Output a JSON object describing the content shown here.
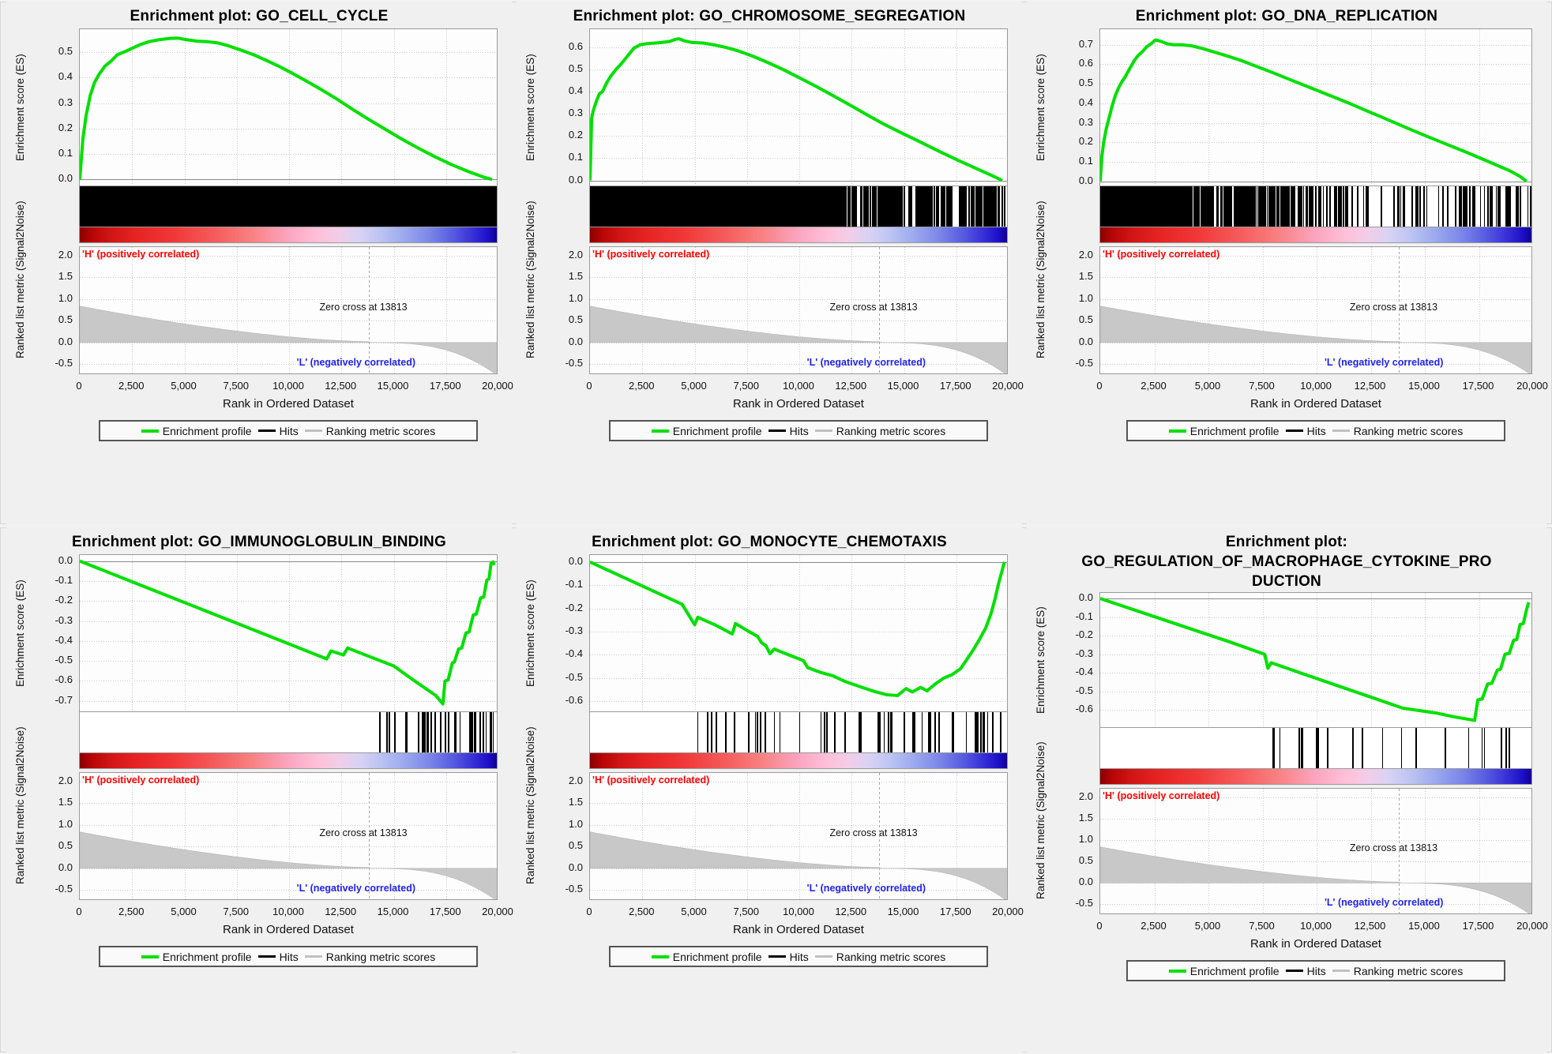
{
  "figure": {
    "background": "#f2f2f2",
    "legend": {
      "enrichment_profile": "Enrichment profile",
      "hits": "Hits",
      "ranking_metric": "Ranking metric scores",
      "colors": {
        "profile": "#00e000",
        "hits": "#000000",
        "metric": "#c0c0c0"
      }
    },
    "common": {
      "xlabel": "Rank in Ordered Dataset",
      "ylabel_es": "Enrichment score (ES)",
      "ylabel_metric": "Ranked list metric (Signal2Noise)",
      "pos_label": "'H' (positively correlated)",
      "neg_label": "'L' (negatively correlated)",
      "zero_cross_label": "Zero cross at 13813",
      "zero_cross_rank": 13813,
      "xticks": [
        "0",
        "2,500",
        "5,000",
        "7,500",
        "10,000",
        "12,500",
        "15,000",
        "17,500",
        "20,000"
      ],
      "xtick_values": [
        0,
        2500,
        5000,
        7500,
        10000,
        12500,
        15000,
        17500,
        20000
      ],
      "xlim": [
        0,
        20000
      ],
      "metric_yticks": [
        "2.0",
        "1.5",
        "1.0",
        "0.5",
        "0.0",
        "-0.5"
      ],
      "metric_ylim": [
        -0.75,
        2.2
      ],
      "pos_color": "#ff0000",
      "neg_color": "#2222ee"
    }
  },
  "chart_data": [
    {
      "id": "cell-cycle",
      "type": "line",
      "title": "Enrichment plot: GO_CELL_CYCLE",
      "gene_set": "GO_CELL_CYCLE",
      "xlabel": "Rank in Ordered Dataset",
      "ylabel": "Enrichment score (ES)",
      "xlim": [
        0,
        20000
      ],
      "ylim": [
        -0.03,
        0.59
      ],
      "yticks": [
        "0.0",
        "0.1",
        "0.2",
        "0.3",
        "0.4",
        "0.5"
      ],
      "ytick_values": [
        0.0,
        0.1,
        0.2,
        0.3,
        0.4,
        0.5
      ],
      "peak_es": 0.555,
      "peak_rank": 4700,
      "direction": "positive",
      "grid": true,
      "es_curve": [
        [
          0,
          0.0
        ],
        [
          150,
          0.16
        ],
        [
          300,
          0.25
        ],
        [
          500,
          0.33
        ],
        [
          700,
          0.38
        ],
        [
          900,
          0.41
        ],
        [
          1200,
          0.445
        ],
        [
          1500,
          0.465
        ],
        [
          1800,
          0.49
        ],
        [
          2100,
          0.5
        ],
        [
          2500,
          0.515
        ],
        [
          2900,
          0.53
        ],
        [
          3300,
          0.541
        ],
        [
          3800,
          0.549
        ],
        [
          4300,
          0.554
        ],
        [
          4700,
          0.555
        ],
        [
          5100,
          0.549
        ],
        [
          5600,
          0.543
        ],
        [
          6100,
          0.541
        ],
        [
          6600,
          0.536
        ],
        [
          7100,
          0.525
        ],
        [
          7700,
          0.508
        ],
        [
          8300,
          0.49
        ],
        [
          8900,
          0.468
        ],
        [
          9500,
          0.445
        ],
        [
          10200,
          0.415
        ],
        [
          10900,
          0.383
        ],
        [
          11600,
          0.35
        ],
        [
          12300,
          0.315
        ],
        [
          13000,
          0.277
        ],
        [
          13800,
          0.236
        ],
        [
          14600,
          0.197
        ],
        [
          15400,
          0.158
        ],
        [
          16200,
          0.122
        ],
        [
          17000,
          0.088
        ],
        [
          17800,
          0.057
        ],
        [
          18600,
          0.03
        ],
        [
          19300,
          0.009
        ],
        [
          19700,
          0.0
        ]
      ],
      "hits_density": "very-high"
    },
    {
      "id": "chromosome-segregation",
      "type": "line",
      "title": "Enrichment plot: GO_CHROMOSOME_SEGREGATION",
      "gene_set": "GO_CHROMOSOME_SEGREGATION",
      "xlabel": "Rank in Ordered Dataset",
      "ylabel": "Enrichment score (ES)",
      "xlim": [
        0,
        20000
      ],
      "ylim": [
        -0.03,
        0.68
      ],
      "yticks": [
        "0.0",
        "0.1",
        "0.2",
        "0.3",
        "0.4",
        "0.5",
        "0.6"
      ],
      "ytick_values": [
        0.0,
        0.1,
        0.2,
        0.3,
        0.4,
        0.5,
        0.6
      ],
      "peak_es": 0.637,
      "peak_rank": 4250,
      "direction": "positive",
      "grid": true,
      "es_curve": [
        [
          0,
          0.0
        ],
        [
          80,
          0.28
        ],
        [
          160,
          0.315
        ],
        [
          300,
          0.355
        ],
        [
          450,
          0.39
        ],
        [
          600,
          0.4
        ],
        [
          800,
          0.44
        ],
        [
          1000,
          0.47
        ],
        [
          1250,
          0.5
        ],
        [
          1500,
          0.525
        ],
        [
          1800,
          0.56
        ],
        [
          2100,
          0.595
        ],
        [
          2400,
          0.61
        ],
        [
          2700,
          0.615
        ],
        [
          3000,
          0.617
        ],
        [
          3400,
          0.62
        ],
        [
          3800,
          0.625
        ],
        [
          4100,
          0.635
        ],
        [
          4250,
          0.637
        ],
        [
          4500,
          0.628
        ],
        [
          4900,
          0.62
        ],
        [
          5400,
          0.618
        ],
        [
          5900,
          0.61
        ],
        [
          6500,
          0.598
        ],
        [
          7100,
          0.582
        ],
        [
          7800,
          0.558
        ],
        [
          8500,
          0.53
        ],
        [
          9200,
          0.5
        ],
        [
          10000,
          0.462
        ],
        [
          10800,
          0.423
        ],
        [
          11600,
          0.382
        ],
        [
          12400,
          0.34
        ],
        [
          13200,
          0.297
        ],
        [
          14000,
          0.255
        ],
        [
          14900,
          0.213
        ],
        [
          15800,
          0.172
        ],
        [
          16700,
          0.13
        ],
        [
          17600,
          0.09
        ],
        [
          18500,
          0.052
        ],
        [
          19200,
          0.022
        ],
        [
          19700,
          0.0
        ]
      ],
      "hits_density": "high"
    },
    {
      "id": "dna-replication",
      "type": "line",
      "title": "Enrichment plot: GO_DNA_REPLICATION",
      "gene_set": "GO_DNA_REPLICATION",
      "xlabel": "Rank in Ordered Dataset",
      "ylabel": "Enrichment score (ES)",
      "xlim": [
        0,
        20000
      ],
      "ylim": [
        -0.03,
        0.78
      ],
      "yticks": [
        "0.0",
        "0.1",
        "0.2",
        "0.3",
        "0.4",
        "0.5",
        "0.6",
        "0.7"
      ],
      "ytick_values": [
        0.0,
        0.1,
        0.2,
        0.3,
        0.4,
        0.5,
        0.6,
        0.7
      ],
      "peak_es": 0.725,
      "peak_rank": 2550,
      "direction": "positive",
      "grid": true,
      "es_curve": [
        [
          0,
          0.0
        ],
        [
          80,
          0.13
        ],
        [
          160,
          0.2
        ],
        [
          280,
          0.27
        ],
        [
          420,
          0.33
        ],
        [
          560,
          0.39
        ],
        [
          700,
          0.44
        ],
        [
          850,
          0.48
        ],
        [
          1000,
          0.51
        ],
        [
          1150,
          0.535
        ],
        [
          1350,
          0.575
        ],
        [
          1550,
          0.615
        ],
        [
          1750,
          0.645
        ],
        [
          1950,
          0.665
        ],
        [
          2150,
          0.69
        ],
        [
          2350,
          0.705
        ],
        [
          2550,
          0.725
        ],
        [
          2800,
          0.718
        ],
        [
          3100,
          0.705
        ],
        [
          3400,
          0.7
        ],
        [
          3800,
          0.7
        ],
        [
          4200,
          0.695
        ],
        [
          4700,
          0.682
        ],
        [
          5200,
          0.665
        ],
        [
          5800,
          0.645
        ],
        [
          6500,
          0.62
        ],
        [
          7200,
          0.59
        ],
        [
          8000,
          0.556
        ],
        [
          8800,
          0.52
        ],
        [
          9600,
          0.485
        ],
        [
          10500,
          0.445
        ],
        [
          11400,
          0.405
        ],
        [
          12300,
          0.362
        ],
        [
          13200,
          0.32
        ],
        [
          14100,
          0.277
        ],
        [
          15000,
          0.235
        ],
        [
          16000,
          0.19
        ],
        [
          17000,
          0.145
        ],
        [
          18000,
          0.098
        ],
        [
          18900,
          0.055
        ],
        [
          19400,
          0.025
        ],
        [
          19700,
          0.0
        ]
      ],
      "hits_density": "medium-high"
    },
    {
      "id": "immunoglobulin-binding",
      "type": "line",
      "title": "Enrichment plot: GO_IMMUNOGLOBULIN_BINDING",
      "gene_set": "GO_IMMUNOGLOBULIN_BINDING",
      "xlabel": "Rank in Ordered Dataset",
      "ylabel": "Enrichment score (ES)",
      "xlim": [
        0,
        20000
      ],
      "ylim": [
        -0.76,
        0.03
      ],
      "yticks": [
        "0.0",
        "-0.1",
        "-0.2",
        "-0.3",
        "-0.4",
        "-0.5",
        "-0.6",
        "-0.7"
      ],
      "ytick_values": [
        0.0,
        -0.1,
        -0.2,
        -0.3,
        -0.4,
        -0.5,
        -0.6,
        -0.7
      ],
      "peak_es": -0.715,
      "peak_rank": 17350,
      "direction": "negative",
      "grid": true,
      "es_curve": [
        [
          0,
          0.0
        ],
        [
          2000,
          -0.083
        ],
        [
          4000,
          -0.166
        ],
        [
          6000,
          -0.249
        ],
        [
          8000,
          -0.332
        ],
        [
          10000,
          -0.415
        ],
        [
          11800,
          -0.49
        ],
        [
          12000,
          -0.45
        ],
        [
          12600,
          -0.47
        ],
        [
          12800,
          -0.435
        ],
        [
          13400,
          -0.46
        ],
        [
          15000,
          -0.525
        ],
        [
          16000,
          -0.6
        ],
        [
          17000,
          -0.672
        ],
        [
          17350,
          -0.715
        ],
        [
          17450,
          -0.6
        ],
        [
          17600,
          -0.595
        ],
        [
          17800,
          -0.51
        ],
        [
          17900,
          -0.505
        ],
        [
          18100,
          -0.44
        ],
        [
          18250,
          -0.435
        ],
        [
          18450,
          -0.36
        ],
        [
          18600,
          -0.355
        ],
        [
          18800,
          -0.27
        ],
        [
          18950,
          -0.265
        ],
        [
          19150,
          -0.185
        ],
        [
          19300,
          -0.18
        ],
        [
          19450,
          -0.095
        ],
        [
          19550,
          -0.09
        ],
        [
          19650,
          -0.01
        ],
        [
          19750,
          -0.005
        ],
        [
          19800,
          -0.02
        ]
      ],
      "hits_density": "sparse-right"
    },
    {
      "id": "monocyte-chemotaxis",
      "type": "line",
      "title": "Enrichment plot: GO_MONOCYTE_CHEMOTAXIS",
      "gene_set": "GO_MONOCYTE_CHEMOTAXIS",
      "xlabel": "Rank in Ordered Dataset",
      "ylabel": "Enrichment score (ES)",
      "xlim": [
        0,
        20000
      ],
      "ylim": [
        -0.65,
        0.03
      ],
      "yticks": [
        "0.0",
        "-0.1",
        "-0.2",
        "-0.3",
        "-0.4",
        "-0.5",
        "-0.6"
      ],
      "ytick_values": [
        0.0,
        -0.1,
        -0.2,
        -0.3,
        -0.4,
        -0.5,
        -0.6
      ],
      "peak_es": -0.575,
      "peak_rank": 14700,
      "direction": "negative",
      "grid": true,
      "es_curve": [
        [
          0,
          0.0
        ],
        [
          1500,
          -0.062
        ],
        [
          3000,
          -0.124
        ],
        [
          4400,
          -0.182
        ],
        [
          5000,
          -0.27
        ],
        [
          5150,
          -0.238
        ],
        [
          6000,
          -0.272
        ],
        [
          6800,
          -0.31
        ],
        [
          6950,
          -0.265
        ],
        [
          7600,
          -0.3
        ],
        [
          8000,
          -0.32
        ],
        [
          8200,
          -0.348
        ],
        [
          8400,
          -0.36
        ],
        [
          8600,
          -0.395
        ],
        [
          8800,
          -0.375
        ],
        [
          9500,
          -0.4
        ],
        [
          10200,
          -0.425
        ],
        [
          10400,
          -0.455
        ],
        [
          11000,
          -0.475
        ],
        [
          11600,
          -0.49
        ],
        [
          12200,
          -0.515
        ],
        [
          13000,
          -0.54
        ],
        [
          13600,
          -0.558
        ],
        [
          14200,
          -0.572
        ],
        [
          14700,
          -0.575
        ],
        [
          15100,
          -0.545
        ],
        [
          15400,
          -0.56
        ],
        [
          15800,
          -0.54
        ],
        [
          16100,
          -0.555
        ],
        [
          16500,
          -0.525
        ],
        [
          16900,
          -0.5
        ],
        [
          17300,
          -0.485
        ],
        [
          17700,
          -0.46
        ],
        [
          18000,
          -0.42
        ],
        [
          18300,
          -0.38
        ],
        [
          18600,
          -0.335
        ],
        [
          18900,
          -0.285
        ],
        [
          19150,
          -0.225
        ],
        [
          19350,
          -0.16
        ],
        [
          19500,
          -0.1
        ],
        [
          19650,
          -0.05
        ],
        [
          19800,
          0.0
        ]
      ],
      "hits_density": "sparse-mid"
    },
    {
      "id": "regulation-macrophage-cytokine",
      "type": "line",
      "title_line1": "Enrichment plot:",
      "title_line2": "GO_REGULATION_OF_MACROPHAGE_CYTOKINE_PRO",
      "title_line3": "DUCTION",
      "gene_set": "GO_REGULATION_OF_MACROPHAGE_CYTOKINE_PRODUCTION",
      "xlabel": "Rank in Ordered Dataset",
      "ylabel": "Enrichment score (ES)",
      "xlim": [
        0,
        20000
      ],
      "ylim": [
        -0.7,
        0.03
      ],
      "yticks": [
        "0.0",
        "-0.1",
        "-0.2",
        "-0.3",
        "-0.4",
        "-0.5",
        "-0.6"
      ],
      "ytick_values": [
        0.0,
        -0.1,
        -0.2,
        -0.3,
        -0.4,
        -0.5,
        -0.6
      ],
      "peak_es": -0.655,
      "peak_rank": 17300,
      "direction": "negative",
      "grid": true,
      "es_curve": [
        [
          0,
          0.0
        ],
        [
          2000,
          -0.078
        ],
        [
          4000,
          -0.156
        ],
        [
          6000,
          -0.234
        ],
        [
          7600,
          -0.3
        ],
        [
          7750,
          -0.375
        ],
        [
          7900,
          -0.345
        ],
        [
          9500,
          -0.41
        ],
        [
          11000,
          -0.47
        ],
        [
          12500,
          -0.53
        ],
        [
          14000,
          -0.59
        ],
        [
          15500,
          -0.615
        ],
        [
          16300,
          -0.635
        ],
        [
          17300,
          -0.655
        ],
        [
          17450,
          -0.545
        ],
        [
          17650,
          -0.54
        ],
        [
          17900,
          -0.46
        ],
        [
          18100,
          -0.455
        ],
        [
          18350,
          -0.385
        ],
        [
          18500,
          -0.38
        ],
        [
          18700,
          -0.3
        ],
        [
          18900,
          -0.295
        ],
        [
          19100,
          -0.225
        ],
        [
          19250,
          -0.22
        ],
        [
          19400,
          -0.14
        ],
        [
          19550,
          -0.135
        ],
        [
          19700,
          -0.06
        ],
        [
          19800,
          -0.02
        ]
      ],
      "hits_density": "very-sparse"
    }
  ]
}
